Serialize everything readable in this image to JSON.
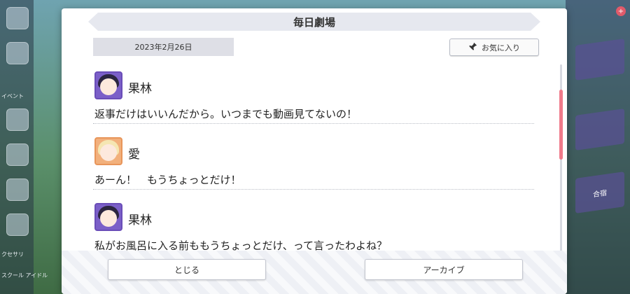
{
  "background": {
    "left_labels": [
      "イベント",
      "クセサリ",
      "スクール アイドル"
    ],
    "right_label": "合宿",
    "badge_count": "+"
  },
  "dialog": {
    "title": "毎日劇場",
    "date": "2023年2月26日",
    "favorite_label": "お気に入り",
    "messages": [
      {
        "speaker": "果林",
        "text": "返事だけはいいんだから。いつまでも動画見てないの！"
      },
      {
        "speaker": "愛",
        "text": "あーん！　もうちょっとだけ！"
      },
      {
        "speaker": "果林",
        "text": "私がお風呂に入る前ももうちょっとだけ、って言ったわよね？"
      }
    ],
    "scroll_position": 0.25,
    "buttons": {
      "close": "とじる",
      "archive": "アーカイブ"
    }
  },
  "colors": {
    "accent": "#f07a8a",
    "header": "#e6e8ef"
  }
}
